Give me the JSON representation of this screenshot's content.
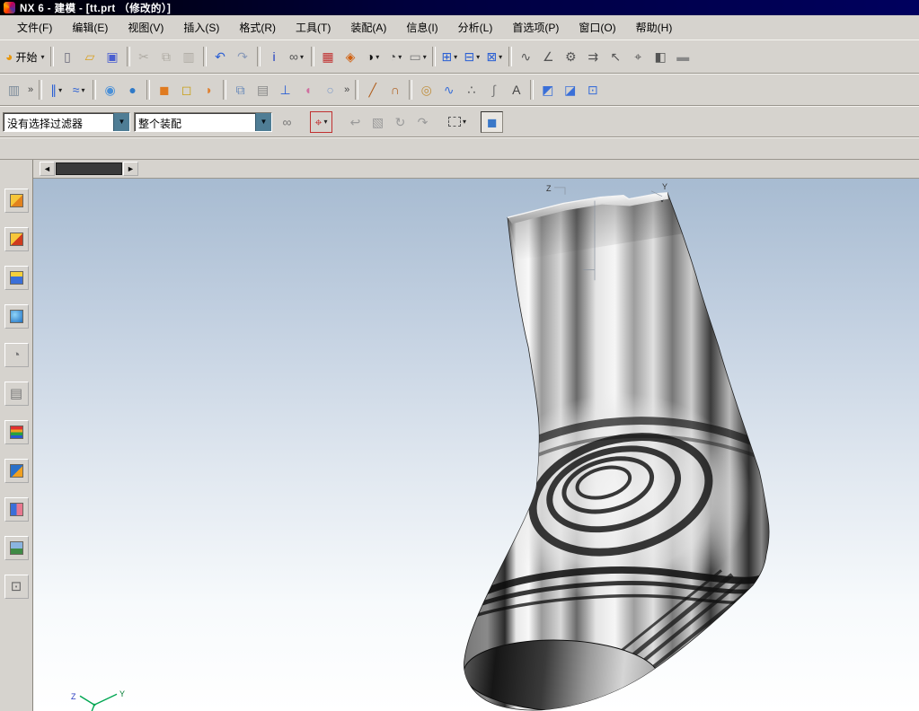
{
  "window": {
    "title": "NX 6 - 建模 - [tt.prt （修改的）]"
  },
  "menu": {
    "items": [
      {
        "name": "menu-file",
        "label": "文件(F)"
      },
      {
        "name": "menu-edit",
        "label": "编辑(E)"
      },
      {
        "name": "menu-view",
        "label": "视图(V)"
      },
      {
        "name": "menu-insert",
        "label": "插入(S)"
      },
      {
        "name": "menu-format",
        "label": "格式(R)"
      },
      {
        "name": "menu-tools",
        "label": "工具(T)"
      },
      {
        "name": "menu-assemblies",
        "label": "装配(A)"
      },
      {
        "name": "menu-information",
        "label": "信息(I)"
      },
      {
        "name": "menu-analysis",
        "label": "分析(L)"
      },
      {
        "name": "menu-preferences",
        "label": "首选项(P)"
      },
      {
        "name": "menu-window",
        "label": "窗口(O)"
      },
      {
        "name": "menu-help",
        "label": "帮助(H)"
      }
    ]
  },
  "toolbars": {
    "main": [
      {
        "name": "start-button",
        "glyph": "◕",
        "color": "#e8960a",
        "label": "开始",
        "arrow": true
      },
      {
        "type": "sep"
      },
      {
        "name": "new-button",
        "glyph": "▯",
        "color": "#666677"
      },
      {
        "name": "open-button",
        "glyph": "▱",
        "color": "#d8a020"
      },
      {
        "name": "save-button",
        "glyph": "▣",
        "color": "#4a5fd0"
      },
      {
        "type": "sep"
      },
      {
        "name": "cut-button",
        "glyph": "✂",
        "color": "#9a9a9a",
        "disabled": true
      },
      {
        "name": "copy-button",
        "glyph": "⧉",
        "color": "#9a9a9a",
        "disabled": true
      },
      {
        "name": "paste-button",
        "glyph": "▥",
        "color": "#9a9a9a",
        "disabled": true
      },
      {
        "type": "sep"
      },
      {
        "name": "undo-button",
        "glyph": "↶",
        "color": "#2a5fd4"
      },
      {
        "name": "redo-button",
        "glyph": "↷",
        "color": "#8a9ab8"
      },
      {
        "type": "sep"
      },
      {
        "name": "information-window-button",
        "glyph": "i",
        "color": "#1a3ac0"
      },
      {
        "name": "find-button",
        "glyph": "∞",
        "color": "#555555",
        "arrow": true
      },
      {
        "type": "sep"
      },
      {
        "name": "display-part-button",
        "glyph": "▦",
        "color": "#c03030"
      },
      {
        "name": "rendering-style-button",
        "glyph": "◈",
        "color": "#d06010"
      },
      {
        "name": "shaded-button",
        "glyph": "◑",
        "color": "#111111",
        "arrow": true
      },
      {
        "name": "orient-view-button",
        "glyph": "◔",
        "color": "#555555",
        "arrow": true
      },
      {
        "name": "background-button",
        "glyph": "▭",
        "color": "#777777",
        "arrow": true
      },
      {
        "type": "sep"
      },
      {
        "name": "fit-view-button",
        "glyph": "⊞",
        "color": "#2a5fd4",
        "arrow": true
      },
      {
        "name": "zoom-button",
        "glyph": "⊟",
        "color": "#2a5fd4",
        "arrow": true
      },
      {
        "name": "pan-button",
        "glyph": "⊠",
        "color": "#2a5fd4",
        "arrow": true
      },
      {
        "type": "sep"
      },
      {
        "name": "deviation-gauge-button",
        "glyph": "∿",
        "color": "#555555"
      },
      {
        "name": "simple-angle-button",
        "glyph": "∠",
        "color": "#555555"
      },
      {
        "name": "preferences-button",
        "glyph": "⚙",
        "color": "#555555"
      },
      {
        "name": "refresh-button",
        "glyph": "⇉",
        "color": "#555555"
      },
      {
        "name": "select-cursor-button",
        "glyph": "↖",
        "color": "#555555"
      },
      {
        "name": "snap-point-button",
        "glyph": "⌖",
        "color": "#555555"
      },
      {
        "name": "measure-distance-button",
        "glyph": "◧",
        "color": "#555555"
      },
      {
        "name": "ruler-button",
        "glyph": "▬",
        "color": "#888888"
      }
    ],
    "view": [
      {
        "name": "sheet-operation-button",
        "glyph": "▥",
        "color": "#7a8a9a"
      },
      {
        "type": "chev",
        "name": "toolbar-overflow-1"
      },
      {
        "type": "sep"
      },
      {
        "name": "section-view-button",
        "glyph": "∥",
        "color": "#2a5fd4",
        "arrow": true
      },
      {
        "name": "curve-connect-button",
        "glyph": "≈",
        "color": "#2a5fd4",
        "arrow": true
      },
      {
        "type": "sep"
      },
      {
        "name": "sphere-wireframe-button",
        "glyph": "◉",
        "color": "#4a90d8"
      },
      {
        "name": "sphere-shaded-button",
        "glyph": "●",
        "color": "#2f7ac8"
      },
      {
        "type": "sep"
      },
      {
        "name": "shaded-solid-button",
        "glyph": "◼",
        "color": "#e07b20"
      },
      {
        "name": "wireframe-solid-button",
        "glyph": "◻",
        "color": "#c8a018"
      },
      {
        "name": "face-shape-button",
        "glyph": "◗",
        "color": "#e08030"
      },
      {
        "type": "sep"
      },
      {
        "name": "layer-settings-button",
        "glyph": "⧉",
        "color": "#6888b8"
      },
      {
        "name": "notebook-button",
        "glyph": "▤",
        "color": "#888888"
      },
      {
        "name": "datum-csys-button",
        "glyph": "⊥",
        "color": "#2a5fd4"
      },
      {
        "name": "freeform-surface-button",
        "glyph": "◖",
        "color": "#d070a0"
      },
      {
        "name": "cylinder-button",
        "glyph": "○",
        "color": "#7a98c8"
      },
      {
        "type": "chev",
        "name": "toolbar-overflow-2"
      },
      {
        "type": "sep"
      },
      {
        "name": "line-button",
        "glyph": "╱",
        "color": "#b06020"
      },
      {
        "name": "arc-button",
        "glyph": "∩",
        "color": "#b06020"
      },
      {
        "type": "sep"
      },
      {
        "name": "basic-curves-button",
        "glyph": "◎",
        "color": "#c09040"
      },
      {
        "name": "studio-spline-button",
        "glyph": "∿",
        "color": "#3a6fd8"
      },
      {
        "name": "point-button",
        "glyph": "∴",
        "color": "#555555"
      },
      {
        "name": "helix-button",
        "glyph": "∫",
        "color": "#777777"
      },
      {
        "name": "text-button",
        "glyph": "A",
        "color": "#444444"
      },
      {
        "type": "sep"
      },
      {
        "name": "ruled-surface-button",
        "glyph": "◩",
        "color": "#3a6fd8"
      },
      {
        "name": "through-curves-button",
        "glyph": "◪",
        "color": "#3a6fd8"
      },
      {
        "name": "swept-surface-button",
        "glyph": "⊡",
        "color": "#3a6fd8"
      }
    ]
  },
  "selection_bar": {
    "filter_value": "没有选择过滤器",
    "scope_value": "整个装配",
    "tools": [
      {
        "name": "interpart-link-button",
        "glyph": "∞",
        "color": "#777777"
      },
      {
        "type": "gap"
      },
      {
        "name": "snap-point-toggle",
        "glyph": "⌖",
        "color": "#c03030",
        "red": true,
        "arrow": true
      },
      {
        "type": "gap"
      },
      {
        "name": "undo-selection-button",
        "glyph": "↩",
        "color": "#999999"
      },
      {
        "name": "show-hide-button",
        "glyph": "▧",
        "color": "#999999"
      },
      {
        "name": "rotate-view-button",
        "glyph": "↻",
        "color": "#999999"
      },
      {
        "name": "orient-wcs-button",
        "glyph": "↷",
        "color": "#999999"
      },
      {
        "type": "gap"
      },
      {
        "name": "rectangle-select-button",
        "dashed": true,
        "arrow": true
      },
      {
        "type": "gap"
      },
      {
        "name": "shaded-display-button",
        "glyph": "◼",
        "color": "#3a78c8",
        "active": true
      }
    ]
  },
  "resource_bar": {
    "items": [
      {
        "name": "assembly-navigator-tab",
        "block": "linear-gradient(135deg,#f6c63a 50%,#e2821e 50%)"
      },
      {
        "name": "constraint-navigator-tab",
        "block": "linear-gradient(135deg,#f6c63a 50%,#cf3b1e 50%)"
      },
      {
        "name": "part-navigator-tab",
        "block": "linear-gradient(180deg,#f6d03a 40%,#3a6fd8 40%)"
      },
      {
        "name": "reuse-library-tab",
        "block": "radial-gradient(circle at 35% 35%,#8fd4f8,#1f6fc0)"
      },
      {
        "name": "hd3d-tools-tab",
        "glyph": "◔",
        "color": "#777777"
      },
      {
        "name": "history-tab",
        "glyph": "▤",
        "color": "#777777"
      },
      {
        "name": "system-materials-tab",
        "block": "linear-gradient(180deg,#e03030 25%,#f0a020 25% 50%,#28a040 50% 75%,#2858d0 75%)"
      },
      {
        "name": "process-studio-tab",
        "block": "linear-gradient(135deg,#2a70c8 55%,#f0a020 55%)"
      },
      {
        "name": "roles-tab",
        "block": "linear-gradient(90deg,#3a6fd8 50%,#e87890 50%)"
      },
      {
        "name": "system-scenes-tab",
        "block": "linear-gradient(180deg,#8ab4e0 55%,#3f8a46 55%)"
      },
      {
        "name": "windows-tab",
        "glyph": "⊡",
        "color": "#666666"
      }
    ]
  },
  "viewport": {
    "scrollbar": {
      "left_glyph": "◄",
      "right_glyph": "►"
    },
    "wcs": {
      "z_label": "Z",
      "y_label": "Y"
    },
    "datum": {
      "z_label": "Z",
      "y_label": "Y"
    }
  },
  "ui": {
    "dropdown_arrow": "▾",
    "combo_arrow": "▼",
    "overflow_glyph": "»"
  }
}
